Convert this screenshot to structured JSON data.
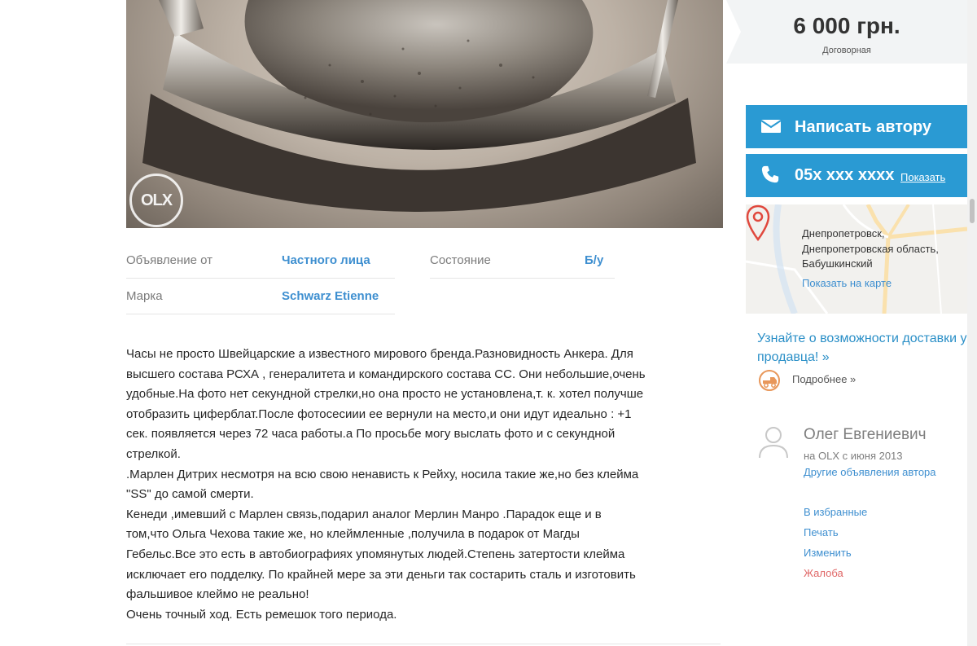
{
  "photo": {
    "watermark": "OLX",
    "alt": "watch"
  },
  "attributes": [
    {
      "label": "Объявление от",
      "value": "Частного лица"
    },
    {
      "label": "Состояние",
      "value": "Б/у"
    },
    {
      "label": "Марка",
      "value": "Schwarz Etienne"
    }
  ],
  "description": [
    "Часы не просто Швейцарские а известного мирового бренда.Разновидность Анкера. Для",
    "высшего состава РСХА , генералитета и командирского состава СС. Они небольшие,очень",
    "удобные.На фото нет секундной стрелки,но она просто не установлена,т. к. хотел получше",
    "отобразить циферблат.После фотосесиии ее вернули на место,и они идут идеально : +1",
    "сек. появляется через 72 часа работы.а По просьбе могу выслать фото и с секундной",
    "стрелкой.",
    ".Марлен Дитрих несмотря на всю свою ненависть к Рейху, носила такие же,но без клейма",
    "\"SS\" до самой смерти.",
    "Кенеди ,имевший с Марлен связь,подарил аналог Мерлин Манро .Парадок еще и в",
    "том,что Ольга Чехова такие же, но клеймленные ,получила в подарок от Магды",
    "Гебельс.Все это есть в автобиографиях упомянутых людей.Степень затертости клейма",
    "исключает его подделку. По крайней мере за эти деньги так состарить сталь и изготовить",
    "фальшивое клеймо не реально!",
    "Очень точный ход. Есть ремешок того периода."
  ],
  "price": {
    "amount": "6 000 грн.",
    "note": "Договорная"
  },
  "contact": {
    "message_button": "Написать автору",
    "phone": "05x xxx xxxx",
    "show_phone": "Показать"
  },
  "location": {
    "lines": [
      "Днепропетровск,",
      "Днепропетровская область,",
      "Бабушкинский"
    ],
    "map_link": "Показать на карте"
  },
  "delivery": {
    "headline": "Узнайте о возможности доставки у продавца! »",
    "more": "Подробнее »"
  },
  "seller": {
    "name": "Олег Евгениевич",
    "since": "на OLX с июня 2013",
    "other_ads": "Другие объявления автора"
  },
  "actions": {
    "favorite": "В избранные",
    "print": "Печать",
    "edit": "Изменить",
    "report": "Жалоба"
  },
  "colors": {
    "accent": "#2a9ad3",
    "link": "#3e8fd0",
    "report": "#e06666"
  },
  "icons": [
    "envelope-icon",
    "phone-icon",
    "map-pin-icon",
    "delivery-icon",
    "user-avatar-icon"
  ]
}
